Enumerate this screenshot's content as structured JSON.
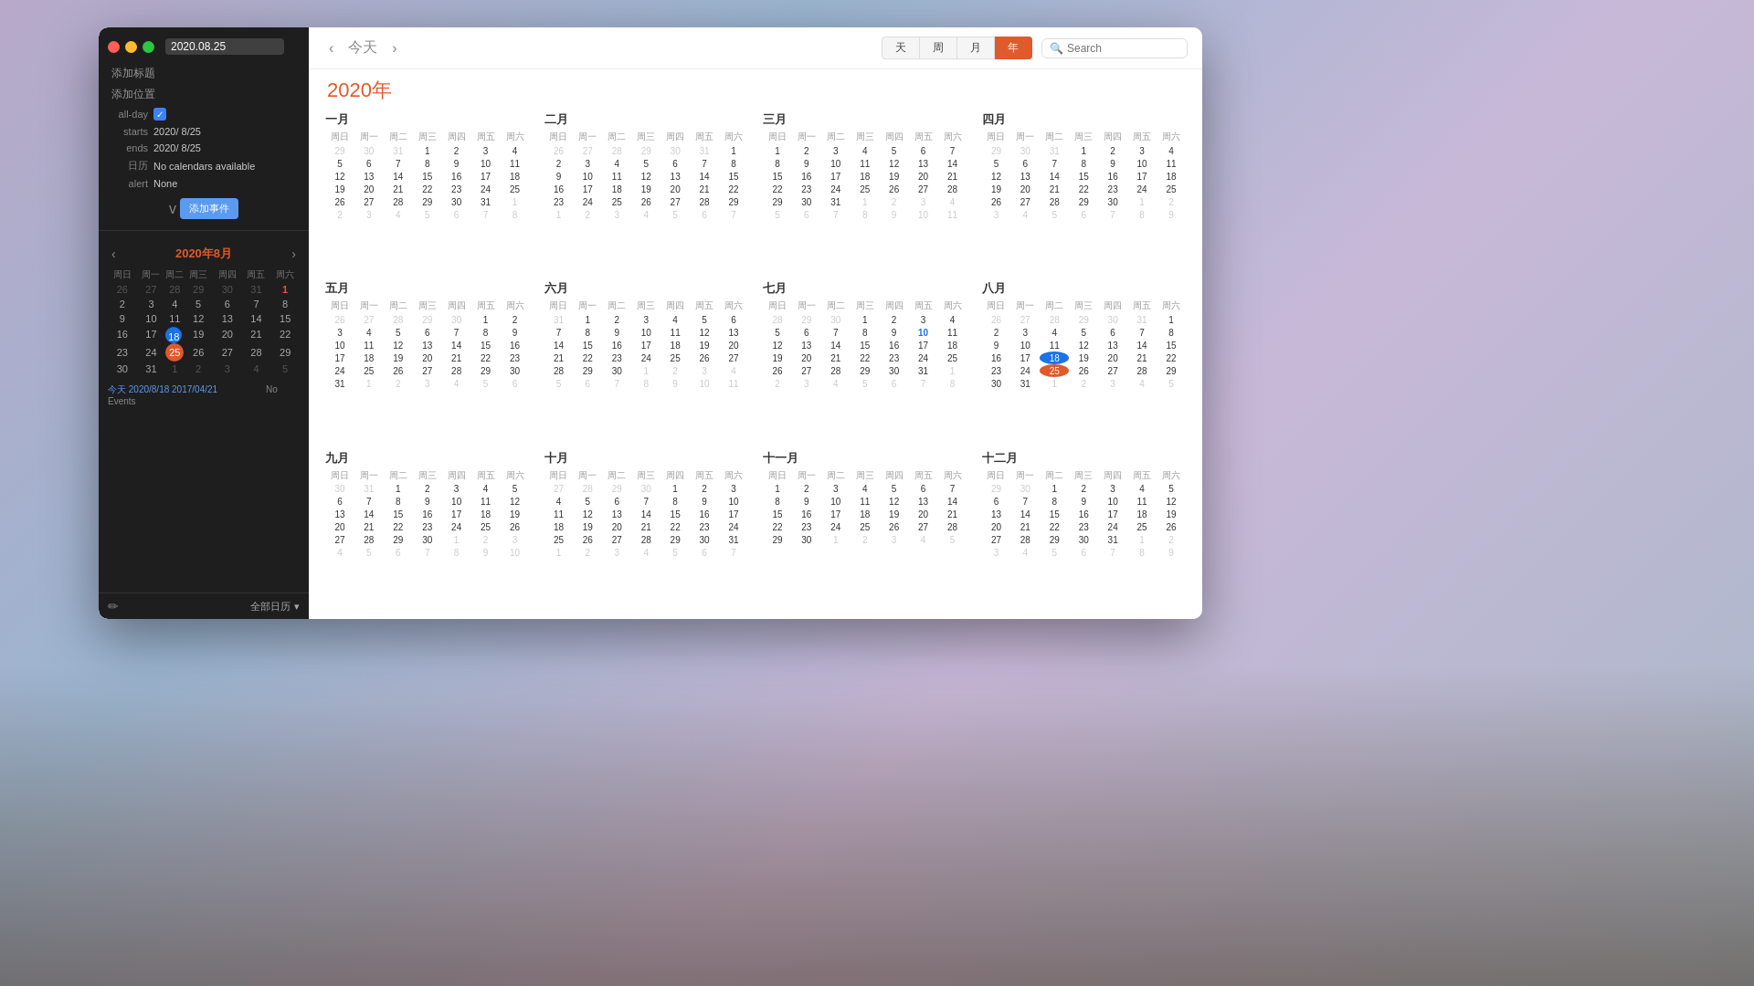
{
  "window": {
    "title": "2020.08.25"
  },
  "sidebar": {
    "add_title": "添加标题",
    "add_location": "添加位置",
    "all_day_label": "all-day",
    "starts_label": "starts",
    "starts_value": "2020/ 8/25",
    "ends_label": "ends",
    "ends_value": "2020/ 8/25",
    "calendar_label": "日历",
    "calendar_value": "No calendars available",
    "alert_label": "alert",
    "alert_value": "None",
    "chevron": "v",
    "add_event_btn": "添加事件",
    "mini_cal_title": "2020年8月",
    "mini_cal_prev": "‹",
    "mini_cal_next": "›",
    "weekdays": [
      "周日",
      "周一",
      "周二",
      "周三",
      "周四",
      "周五",
      "周六"
    ],
    "weeks": [
      [
        "26",
        "27",
        "28",
        "29",
        "30",
        "31",
        "1"
      ],
      [
        "2",
        "3",
        "4",
        "5",
        "6",
        "7",
        "8"
      ],
      [
        "9",
        "10",
        "11",
        "12",
        "13",
        "14",
        "15"
      ],
      [
        "16",
        "17",
        "18",
        "19",
        "20",
        "21",
        "22"
      ],
      [
        "23",
        "24",
        "25",
        "26",
        "27",
        "28",
        "29"
      ],
      [
        "30",
        "31",
        "1",
        "2",
        "3",
        "4",
        "5"
      ]
    ],
    "today_text": "今天 2020/8/18",
    "dates_links": "2017/04/21",
    "no_events": "No Events",
    "edit_icon": "✏",
    "all_calendars": "全部日历",
    "all_calendars_arrow": "▾"
  },
  "toolbar": {
    "prev": "‹",
    "next": "›",
    "today": "今天",
    "view_day": "天",
    "view_week": "周",
    "view_month": "月",
    "view_year": "年",
    "search_placeholder": "Search"
  },
  "year": {
    "title": "2020年",
    "months": [
      {
        "name": "一月",
        "weekdays": [
          "周日",
          "周一",
          "周二",
          "周三",
          "周四",
          "周五",
          "周六"
        ],
        "weeks": [
          [
            "29",
            "30",
            "31",
            "1",
            "2",
            "3",
            "4"
          ],
          [
            "5",
            "6",
            "7",
            "8",
            "9",
            "10",
            "11"
          ],
          [
            "12",
            "13",
            "14",
            "15",
            "16",
            "17",
            "18"
          ],
          [
            "19",
            "20",
            "21",
            "22",
            "23",
            "24",
            "25"
          ],
          [
            "26",
            "27",
            "28",
            "29",
            "30",
            "31",
            "1"
          ],
          [
            "2",
            "3",
            "4",
            "5",
            "6",
            "7",
            "8"
          ]
        ]
      },
      {
        "name": "二月",
        "weekdays": [
          "周日",
          "周一",
          "周二",
          "周三",
          "周四",
          "周五",
          "周六"
        ],
        "weeks": [
          [
            "26",
            "27",
            "28",
            "29",
            "30",
            "31",
            "1"
          ],
          [
            "2",
            "3",
            "4",
            "5",
            "6",
            "7",
            "8"
          ],
          [
            "9",
            "10",
            "11",
            "12",
            "13",
            "14",
            "15"
          ],
          [
            "16",
            "17",
            "18",
            "19",
            "20",
            "21",
            "22"
          ],
          [
            "23",
            "24",
            "25",
            "26",
            "27",
            "28",
            "29"
          ],
          [
            "1",
            "2",
            "3",
            "4",
            "5",
            "6",
            "7"
          ]
        ]
      },
      {
        "name": "三月",
        "weekdays": [
          "周日",
          "周一",
          "周二",
          "周三",
          "周四",
          "周五",
          "周六"
        ],
        "weeks": [
          [
            "1",
            "2",
            "3",
            "4",
            "5",
            "6",
            "7"
          ],
          [
            "8",
            "9",
            "10",
            "11",
            "12",
            "13",
            "14"
          ],
          [
            "15",
            "16",
            "17",
            "18",
            "19",
            "20",
            "21"
          ],
          [
            "22",
            "23",
            "24",
            "25",
            "26",
            "27",
            "28"
          ],
          [
            "29",
            "30",
            "31",
            "1",
            "2",
            "3",
            "4"
          ],
          [
            "5",
            "6",
            "7",
            "8",
            "9",
            "10",
            "11"
          ]
        ]
      },
      {
        "name": "四月",
        "weekdays": [
          "周日",
          "周一",
          "周二",
          "周三",
          "周四",
          "周五",
          "周六"
        ],
        "weeks": [
          [
            "29",
            "30",
            "31",
            "1",
            "2",
            "3",
            "4"
          ],
          [
            "5",
            "6",
            "7",
            "8",
            "9",
            "10",
            "11"
          ],
          [
            "12",
            "13",
            "14",
            "15",
            "16",
            "17",
            "18"
          ],
          [
            "19",
            "20",
            "21",
            "22",
            "23",
            "24",
            "25"
          ],
          [
            "26",
            "27",
            "28",
            "29",
            "30",
            "1",
            "2"
          ],
          [
            "3",
            "4",
            "5",
            "6",
            "7",
            "8",
            "9"
          ]
        ]
      },
      {
        "name": "五月",
        "weekdays": [
          "周日",
          "周一",
          "周二",
          "周三",
          "周四",
          "周五",
          "周六"
        ],
        "weeks": [
          [
            "26",
            "27",
            "28",
            "29",
            "30",
            "1",
            "2"
          ],
          [
            "3",
            "4",
            "5",
            "6",
            "7",
            "8",
            "9"
          ],
          [
            "10",
            "11",
            "12",
            "13",
            "14",
            "15",
            "16"
          ],
          [
            "17",
            "18",
            "19",
            "20",
            "21",
            "22",
            "23"
          ],
          [
            "24",
            "25",
            "26",
            "27",
            "28",
            "29",
            "30"
          ],
          [
            "31",
            "1",
            "2",
            "3",
            "4",
            "5",
            "6"
          ]
        ]
      },
      {
        "name": "六月",
        "weekdays": [
          "周日",
          "周一",
          "周二",
          "周三",
          "周四",
          "周五",
          "周六"
        ],
        "weeks": [
          [
            "31",
            "1",
            "2",
            "3",
            "4",
            "5",
            "6"
          ],
          [
            "7",
            "8",
            "9",
            "10",
            "11",
            "12",
            "13"
          ],
          [
            "14",
            "15",
            "16",
            "17",
            "18",
            "19",
            "20"
          ],
          [
            "21",
            "22",
            "23",
            "24",
            "25",
            "26",
            "27"
          ],
          [
            "28",
            "29",
            "30",
            "1",
            "2",
            "3",
            "4"
          ],
          [
            "5",
            "6",
            "7",
            "8",
            "9",
            "10",
            "11"
          ]
        ]
      },
      {
        "name": "七月",
        "weekdays": [
          "周日",
          "周一",
          "周二",
          "周三",
          "周四",
          "周五",
          "周六"
        ],
        "weeks": [
          [
            "28",
            "29",
            "30",
            "1",
            "2",
            "3",
            "4"
          ],
          [
            "5",
            "6",
            "7",
            "8",
            "9",
            "10",
            "11"
          ],
          [
            "12",
            "13",
            "14",
            "15",
            "16",
            "17",
            "18"
          ],
          [
            "19",
            "20",
            "21",
            "22",
            "23",
            "24",
            "25"
          ],
          [
            "26",
            "27",
            "28",
            "29",
            "30",
            "31",
            "1"
          ],
          [
            "2",
            "3",
            "4",
            "5",
            "6",
            "7",
            "8"
          ]
        ]
      },
      {
        "name": "八月",
        "weekdays": [
          "周日",
          "周一",
          "周二",
          "周三",
          "周四",
          "周五",
          "周六"
        ],
        "weeks": [
          [
            "26",
            "27",
            "28",
            "29",
            "30",
            "31",
            "1"
          ],
          [
            "2",
            "3",
            "4",
            "5",
            "6",
            "7",
            "8"
          ],
          [
            "9",
            "10",
            "11",
            "12",
            "13",
            "14",
            "15"
          ],
          [
            "16",
            "17",
            "18",
            "19",
            "20",
            "21",
            "22"
          ],
          [
            "23",
            "24",
            "25",
            "26",
            "27",
            "28",
            "29"
          ],
          [
            "30",
            "31",
            "1",
            "2",
            "3",
            "4",
            "5"
          ]
        ]
      },
      {
        "name": "九月",
        "weekdays": [
          "周日",
          "周一",
          "周二",
          "周三",
          "周四",
          "周五",
          "周六"
        ],
        "weeks": [
          [
            "30",
            "31",
            "1",
            "2",
            "3",
            "4",
            "5"
          ],
          [
            "6",
            "7",
            "8",
            "9",
            "10",
            "11",
            "12"
          ],
          [
            "13",
            "14",
            "15",
            "16",
            "17",
            "18",
            "19"
          ],
          [
            "20",
            "21",
            "22",
            "23",
            "24",
            "25",
            "26"
          ],
          [
            "27",
            "28",
            "29",
            "30",
            "1",
            "2",
            "3"
          ],
          [
            "4",
            "5",
            "6",
            "7",
            "8",
            "9",
            "10"
          ]
        ]
      },
      {
        "name": "十月",
        "weekdays": [
          "周日",
          "周一",
          "周二",
          "周三",
          "周四",
          "周五",
          "周六"
        ],
        "weeks": [
          [
            "27",
            "28",
            "29",
            "30",
            "1",
            "2",
            "3"
          ],
          [
            "4",
            "5",
            "6",
            "7",
            "8",
            "9",
            "10"
          ],
          [
            "11",
            "12",
            "13",
            "14",
            "15",
            "16",
            "17"
          ],
          [
            "18",
            "19",
            "20",
            "21",
            "22",
            "23",
            "24"
          ],
          [
            "25",
            "26",
            "27",
            "28",
            "29",
            "30",
            "31"
          ],
          [
            "1",
            "2",
            "3",
            "4",
            "5",
            "6",
            "7"
          ]
        ]
      },
      {
        "name": "十一月",
        "weekdays": [
          "周日",
          "周一",
          "周二",
          "周三",
          "周四",
          "周五",
          "周六"
        ],
        "weeks": [
          [
            "1",
            "2",
            "3",
            "4",
            "5",
            "6",
            "7"
          ],
          [
            "8",
            "9",
            "10",
            "11",
            "12",
            "13",
            "14"
          ],
          [
            "15",
            "16",
            "17",
            "18",
            "19",
            "20",
            "21"
          ],
          [
            "22",
            "23",
            "24",
            "25",
            "26",
            "27",
            "28"
          ],
          [
            "29",
            "30",
            "1",
            "2",
            "3",
            "4",
            "5"
          ]
        ]
      },
      {
        "name": "十二月",
        "weekdays": [
          "周日",
          "周一",
          "周二",
          "周三",
          "周四",
          "周五",
          "周六"
        ],
        "weeks": [
          [
            "29",
            "30",
            "1",
            "2",
            "3",
            "4",
            "5"
          ],
          [
            "6",
            "7",
            "8",
            "9",
            "10",
            "11",
            "12"
          ],
          [
            "13",
            "14",
            "15",
            "16",
            "17",
            "18",
            "19"
          ],
          [
            "20",
            "21",
            "22",
            "23",
            "24",
            "25",
            "26"
          ],
          [
            "27",
            "28",
            "29",
            "30",
            "31",
            "1",
            "2"
          ],
          [
            "3",
            "4",
            "5",
            "6",
            "7",
            "8",
            "9"
          ]
        ]
      }
    ]
  }
}
